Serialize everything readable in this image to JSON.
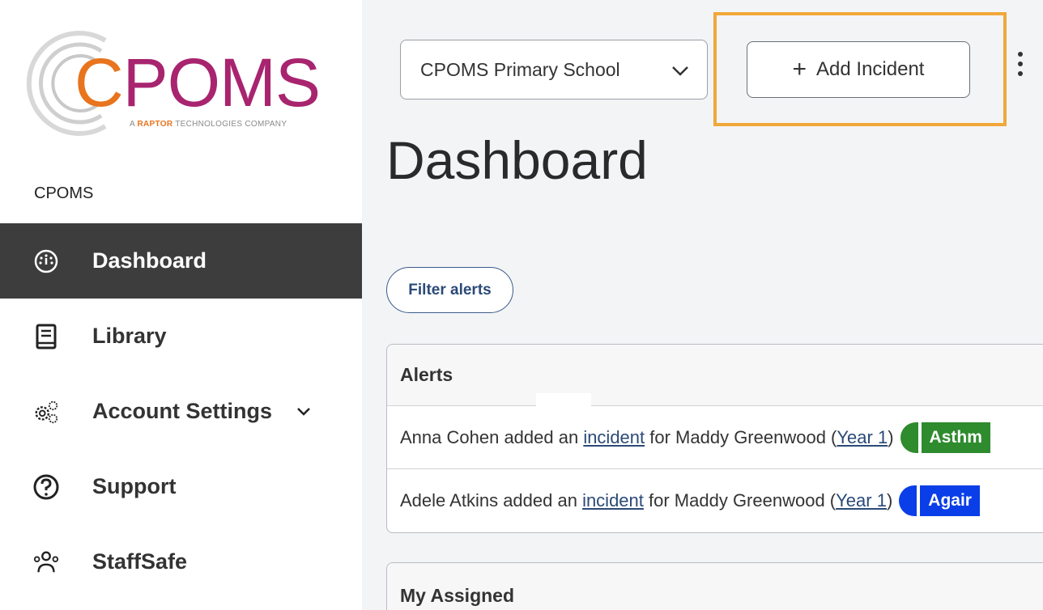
{
  "sidebar": {
    "logo": {
      "text_c": "C",
      "text_rest": "POMS",
      "subtitle_prefix": "A ",
      "subtitle_brand": "RAPTOR",
      "subtitle_suffix": " TECHNOLOGIES COMPANY"
    },
    "org_label": "CPOMS",
    "items": [
      {
        "label": "Dashboard",
        "icon": "dashboard-gauge-icon",
        "active": true
      },
      {
        "label": "Library",
        "icon": "book-icon",
        "active": false
      },
      {
        "label": "Account Settings",
        "icon": "gears-icon",
        "active": false,
        "has_chevron": true
      },
      {
        "label": "Support",
        "icon": "question-circle-icon",
        "active": false
      },
      {
        "label": "StaffSafe",
        "icon": "people-group-icon",
        "active": false
      }
    ]
  },
  "header": {
    "school_select": "CPOMS Primary School",
    "add_incident": "Add Incident"
  },
  "page_title": "Dashboard",
  "filter_alerts": "Filter alerts",
  "alerts": {
    "title": "Alerts",
    "rows": [
      {
        "actor": "Anna Cohen",
        "added": " added an ",
        "link": "incident",
        "for": " for Maddy Greenwood (",
        "year": "Year 1",
        "close": ")",
        "tag": "Asthm",
        "tag_color": "#2e8b2e"
      },
      {
        "actor": "Adele Atkins",
        "added": " added an ",
        "link": "incident",
        "for": " for Maddy Greenwood (",
        "year": "Year 1",
        "close": ")",
        "tag": "Agair",
        "tag_color": "#0a3ee8"
      }
    ]
  },
  "assigned": {
    "title": "My Assigned"
  },
  "colors": {
    "sidebar_active": "#3d3d3d",
    "brand_magenta": "#a8246f",
    "brand_orange": "#e8741e",
    "highlight": "#f0a83a"
  }
}
